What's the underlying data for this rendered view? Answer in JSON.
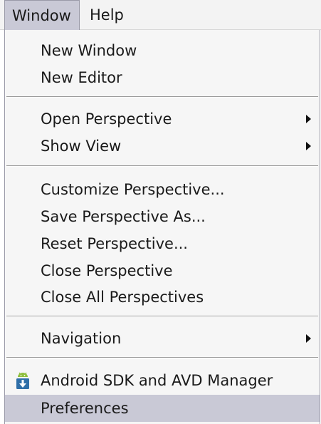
{
  "menubar": {
    "items": [
      {
        "label": "Window"
      },
      {
        "label": "Help"
      }
    ]
  },
  "menu": {
    "groups": [
      {
        "items": [
          {
            "label": "New Window"
          },
          {
            "label": "New Editor"
          }
        ]
      },
      {
        "items": [
          {
            "label": "Open Perspective",
            "submenu": true
          },
          {
            "label": "Show View",
            "submenu": true
          }
        ]
      },
      {
        "items": [
          {
            "label": "Customize Perspective..."
          },
          {
            "label": "Save Perspective As..."
          },
          {
            "label": "Reset Perspective..."
          },
          {
            "label": "Close Perspective"
          },
          {
            "label": "Close All Perspectives"
          }
        ]
      },
      {
        "items": [
          {
            "label": "Navigation",
            "submenu": true
          }
        ]
      },
      {
        "items": [
          {
            "label": "Android SDK and AVD Manager",
            "icon": "android-sdk-icon"
          },
          {
            "label": "Preferences",
            "highlighted": true
          }
        ]
      }
    ]
  },
  "colors": {
    "menu_background": "#f6f6f6",
    "highlight": "#c9c9d6",
    "android_green": "#8fbf3f",
    "android_blue": "#2f6fa8"
  }
}
